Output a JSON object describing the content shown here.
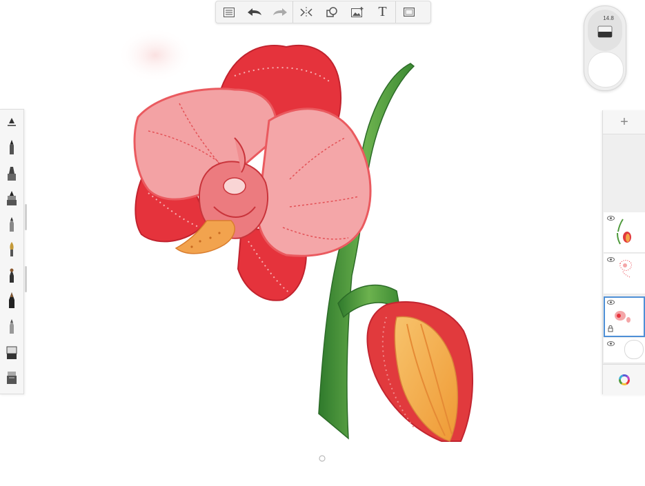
{
  "app": {
    "name": ""
  },
  "toolbar": {
    "buttons": [
      {
        "id": "gallery",
        "icon": "list-icon"
      },
      {
        "id": "undo",
        "icon": "undo-arrow-icon"
      },
      {
        "id": "redo",
        "icon": "redo-arrow-icon"
      },
      {
        "id": "symmetry",
        "icon": "symmetry-icon"
      },
      {
        "id": "shapes",
        "icon": "shapes-icon"
      },
      {
        "id": "image",
        "icon": "add-image-icon"
      },
      {
        "id": "text",
        "icon": "text-icon",
        "label": "T"
      },
      {
        "id": "fullscreen",
        "icon": "fullscreen-icon"
      }
    ]
  },
  "brush_puck": {
    "size": "14.8"
  },
  "brushes": {
    "items": [
      {
        "name": "brush-size-selector"
      },
      {
        "name": "pencil"
      },
      {
        "name": "marker"
      },
      {
        "name": "fineliner"
      },
      {
        "name": "ballpoint"
      },
      {
        "name": "paintbrush"
      },
      {
        "name": "airbrush"
      },
      {
        "name": "ink-pen"
      },
      {
        "name": "soft-brush"
      },
      {
        "name": "eraser"
      },
      {
        "name": "smudge"
      }
    ]
  },
  "layers": {
    "add_label": "+",
    "items": [
      {
        "name": "layer-stem-bud",
        "visible": true,
        "active": false
      },
      {
        "name": "layer-flower-sketch",
        "visible": true,
        "active": false
      },
      {
        "name": "layer-flower-color",
        "visible": true,
        "active": true
      },
      {
        "name": "layer-background",
        "visible": true,
        "active": false
      }
    ]
  },
  "colors": {
    "petal_red": "#e8343e",
    "petal_pink": "#f4a6a8",
    "stem_green": "#4e9a3c",
    "bud_orange": "#f3a649",
    "accent_blue": "#4d8fd6"
  }
}
